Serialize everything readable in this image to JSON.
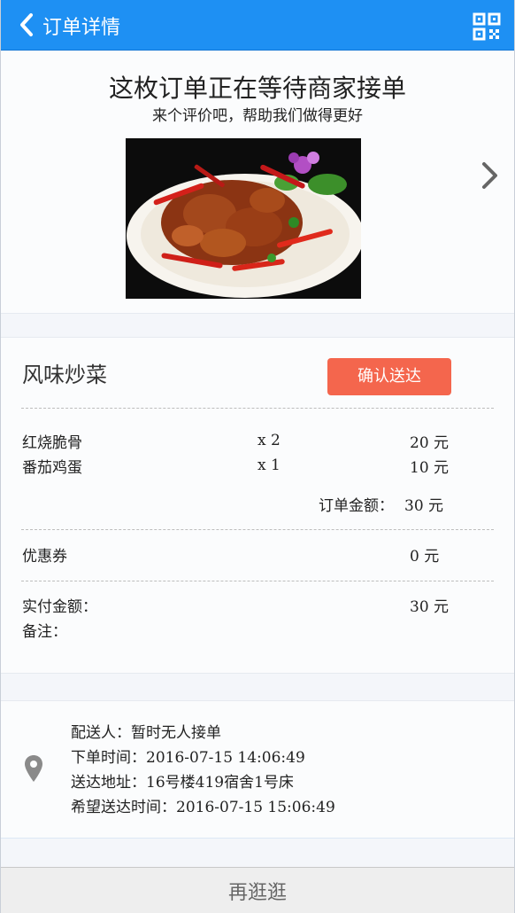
{
  "header": {
    "title": "订单详情",
    "back_icon": "back-chevron-icon",
    "qr_icon": "qr-code-icon",
    "background": "#1e90f3"
  },
  "status": {
    "title": "这枚订单正在等待商家接单",
    "subtitle": "来个评价吧，帮助我们做得更好"
  },
  "order": {
    "shop_name": "风味炒菜",
    "confirm_label": "确认送达",
    "confirm_color": "#f4664d",
    "items": [
      {
        "name": "红烧脆骨",
        "qty": "x 2",
        "price": "20 元"
      },
      {
        "name": "番茄鸡蛋",
        "qty": "x 1",
        "price": "10 元"
      }
    ],
    "order_total_label": "订单金额：",
    "order_total_value": "30 元",
    "coupon_label": "优惠券",
    "coupon_value": "0 元",
    "paid_label": "实付金额：",
    "paid_value": "30 元",
    "note_label": "备注："
  },
  "delivery": {
    "courier_label": "配送人：",
    "courier_value": "暂时无人接单",
    "order_time_label": "下单时间：",
    "order_time_value": "2016-07-15 14:06:49",
    "address_label": "送达地址：",
    "address_value": "16号楼419宿舍1号床",
    "expected_time_label": "希望送达时间：",
    "expected_time_value": "2016-07-15 15:06:49"
  },
  "bottom": {
    "label": "再逛逛"
  }
}
